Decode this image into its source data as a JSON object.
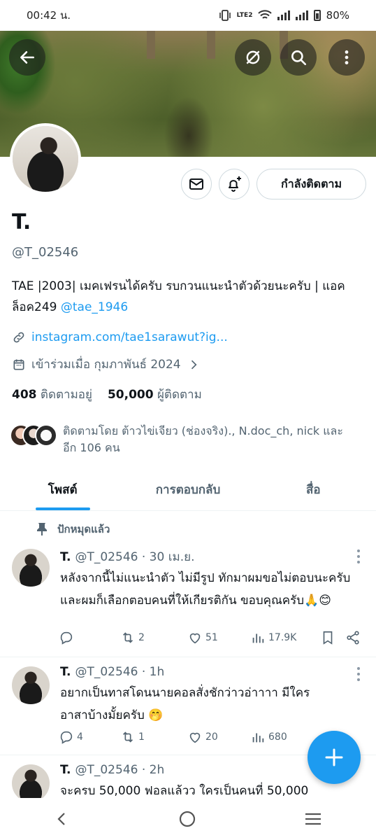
{
  "status_bar": {
    "time": "00:42 น.",
    "battery": "80%",
    "network": "LTE2"
  },
  "profile": {
    "name": "T.",
    "handle": "@T_02546",
    "bio_text": "TAE |2003| เมคเฟรนได้ครับ รบกวนแนะนำตัวด้วยนะครับ | แอคล็อค249 ",
    "bio_mention": "@tae_1946",
    "website": "instagram.com/tae1sarawut?ig...",
    "joined": "เข้าร่วมเมื่อ กุมภาพันธ์ 2024",
    "following_count": "408",
    "following_label": "ติดตามอยู่",
    "followers_count": "50,000",
    "followers_label": "ผู้ติดตาม",
    "followed_by": "ติดตามโดย ต้าวไข่เจียว (ช่องจริง)., N.doc_ch, nick และอีก 106 คน",
    "follow_button": "กำลังติดตาม"
  },
  "tabs": [
    {
      "label": "โพสต์",
      "active": true
    },
    {
      "label": "การตอบกลับ",
      "active": false
    },
    {
      "label": "สื่อ",
      "active": false
    }
  ],
  "pinned_label": "ปักหมุดแล้ว",
  "tweets": [
    {
      "name": "T.",
      "meta": "@T_02546 · 30 เม.ย.",
      "text": "หลังจากนี้ไม่แนะนำตัว ไม่มีรูป ทักมาผมขอไม่ตอบนะครับ และผมก็เลือกตอบคนที่ให้เกียรติกัน ขอบคุณครับ🙏😊",
      "replies": "",
      "retweets": "2",
      "likes": "51",
      "views": "17.9K"
    },
    {
      "name": "T.",
      "meta": "@T_02546 · 1h",
      "text": "อยากเป็นทาสโดนนายคอลสั่งชักว่าวอ่าาาา มีใครอาสาบ้างมั้ยครับ 🤭",
      "replies": "4",
      "retweets": "1",
      "likes": "20",
      "views": "680"
    },
    {
      "name": "T.",
      "meta": "@T_02546 · 2h",
      "text": "จะครบ 50,000 ฟอลแล้วว ใครเป็นคนที่ 50,000"
    }
  ],
  "colors": {
    "accent": "#1d9bf0",
    "secondary_text": "#536471"
  }
}
